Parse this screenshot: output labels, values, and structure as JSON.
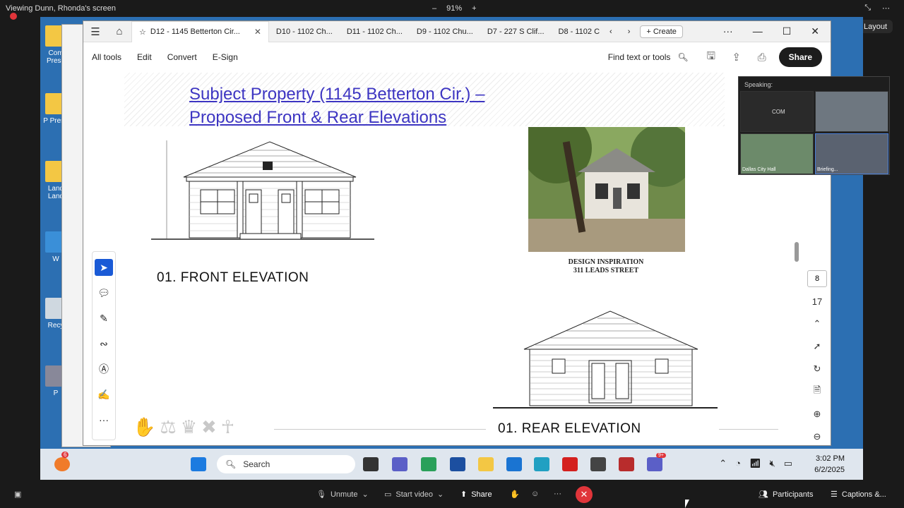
{
  "share_bar": {
    "viewing": "Viewing Dunn, Rhonda's screen",
    "zoom": "91%",
    "zoom_minus": "–",
    "zoom_plus": "+",
    "layout": "Layout"
  },
  "desktop_icons": [
    "Com Prese",
    "P Prese",
    "Land Land",
    "W",
    "Recy",
    "P"
  ],
  "browser": {
    "tabs": [
      {
        "label": "D12 - 1145 Betterton Cir..."
      },
      {
        "label": "D10 - 1102 Ch..."
      },
      {
        "label": "D11 - 1102 Ch..."
      },
      {
        "label": "D9 - 1102 Chu..."
      },
      {
        "label": "D7 - 227 S Clif..."
      },
      {
        "label": "D8 - 1102 C"
      }
    ],
    "create": "Create"
  },
  "toolbar": {
    "menu": [
      "All tools",
      "Edit",
      "Convert",
      "E-Sign"
    ],
    "find": "Find text or tools",
    "share": "Share"
  },
  "doc": {
    "title_line1": "Subject Property (1145 Betterton Cir.) –",
    "title_line2": "Proposed Front & Rear Elevations",
    "front_caption": "01. FRONT ELEVATION",
    "rear_caption": "01. REAR ELEVATION",
    "inspiration_line1": "DESIGN INSPIRATION",
    "inspiration_line2": "311 LEADS STREET"
  },
  "page_nav": {
    "current": "8",
    "total": "17"
  },
  "video_panel": {
    "speaking": "Speaking:",
    "tile1": "COM",
    "tile3": "Dallas City Hall",
    "tile4": "Briefing..."
  },
  "taskbar": {
    "search": "Search",
    "time": "3:02 PM",
    "date": "6/2/2025",
    "badge_left": "6",
    "badge_teams": "9+"
  },
  "zoom_controls": {
    "unmute": "Unmute",
    "start_video": "Start video",
    "share": "Share",
    "participants": "Participants",
    "captions": "Captions &..."
  }
}
